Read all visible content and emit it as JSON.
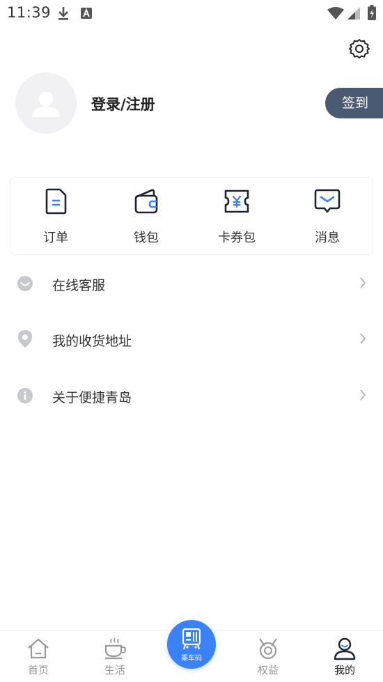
{
  "status_bar": {
    "time": "11:39",
    "icons": [
      "download-icon",
      "a-notification-icon",
      "wifi-icon",
      "signal-icon",
      "battery-icon"
    ]
  },
  "profile": {
    "login_label": "登录/注册",
    "checkin_label": "签到"
  },
  "quick_actions": [
    {
      "label": "订单",
      "icon": "order-icon"
    },
    {
      "label": "钱包",
      "icon": "wallet-icon"
    },
    {
      "label": "卡券包",
      "icon": "coupon-icon"
    },
    {
      "label": "消息",
      "icon": "message-icon"
    }
  ],
  "menu": [
    {
      "label": "在线客服",
      "icon": "customer-service-icon"
    },
    {
      "label": "我的收货地址",
      "icon": "location-icon"
    },
    {
      "label": "关于便捷青岛",
      "icon": "info-icon"
    }
  ],
  "tabbar": {
    "tabs": [
      {
        "label": "首页",
        "icon": "home-icon"
      },
      {
        "label": "生活",
        "icon": "coffee-icon"
      },
      {
        "label": "权益",
        "icon": "medal-icon"
      },
      {
        "label": "我的",
        "icon": "user-icon"
      }
    ],
    "ride_label": "乘车码",
    "active_tab": "我的"
  },
  "colors": {
    "accent": "#3b82f6",
    "checkin_bg": "#4b5a73",
    "icon_dark": "#1f2233",
    "icon_blue": "#3b82f6",
    "menu_icon": "#c8c9ce",
    "tab_inactive": "#999999"
  }
}
